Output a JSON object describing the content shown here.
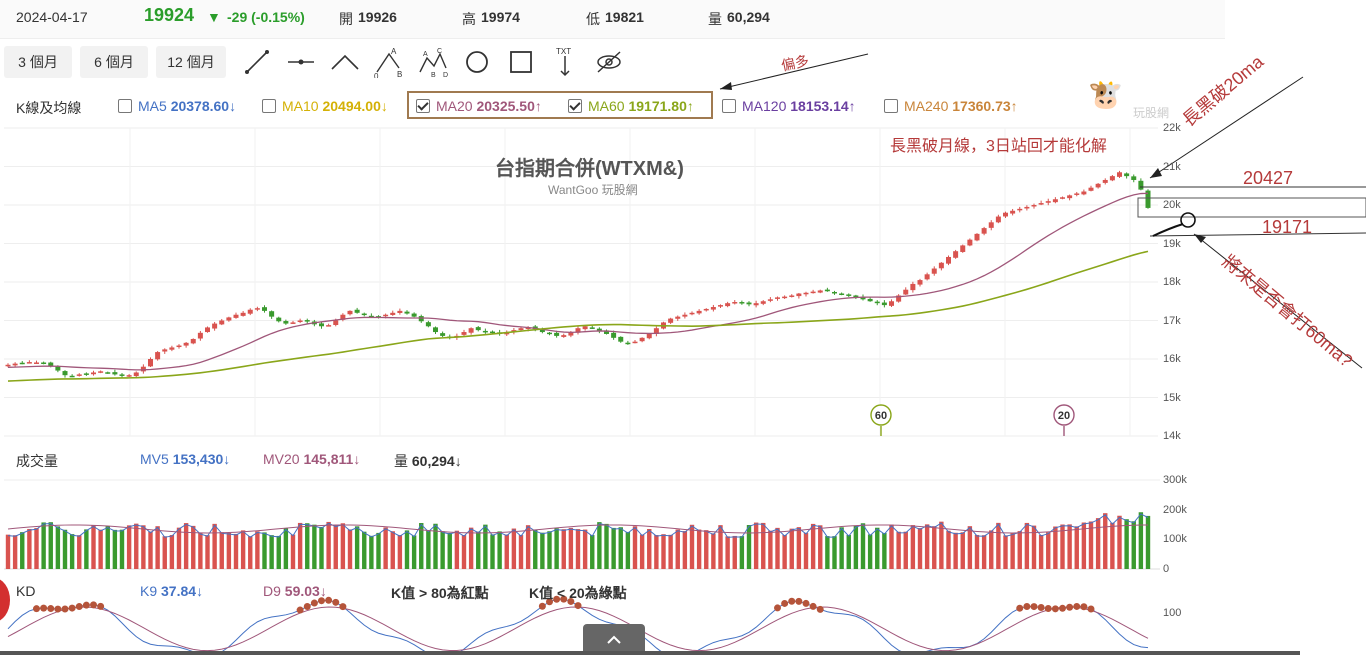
{
  "header": {
    "date": "2024-04-17",
    "price": "19924",
    "change": "-29 (-0.15%)",
    "open_label": "開",
    "open_value": "19926",
    "high_label": "高",
    "high_value": "19974",
    "low_label": "低",
    "low_value": "19821",
    "volume_label": "量",
    "volume_value": "60,294"
  },
  "range_buttons": [
    "3 個月",
    "6 個月",
    "12 個月"
  ],
  "tools": [
    "line-tool-icon",
    "horizontal-line-tool-icon",
    "peak-tool-icon",
    "abc-pattern-icon",
    "abcd-pattern-icon",
    "circle-tool-icon",
    "rectangle-tool-icon",
    "text-arrow-tool-icon",
    "hide-eye-icon"
  ],
  "tool_letters": {
    "a": "A",
    "b": "B",
    "c": "C",
    "d": "D",
    "zero": "0",
    "txt": "TXT"
  },
  "kline": {
    "section_label": "K線及均線",
    "ma": [
      {
        "name": "MA5",
        "value": "20378.60",
        "arrow": "↓",
        "checked": false,
        "color": "#4472c4"
      },
      {
        "name": "MA10",
        "value": "20494.00",
        "arrow": "↓",
        "checked": false,
        "color": "#d4b106"
      },
      {
        "name": "MA20",
        "value": "20325.50",
        "arrow": "↑",
        "checked": true,
        "color": "#a0577a"
      },
      {
        "name": "MA60",
        "value": "19171.80",
        "arrow": "↑",
        "checked": true,
        "color": "#8aa61a"
      },
      {
        "name": "MA120",
        "value": "18153.14",
        "arrow": "↑",
        "checked": false,
        "color": "#6a3fa0"
      },
      {
        "name": "MA240",
        "value": "17360.73",
        "arrow": "↑",
        "checked": false,
        "color": "#c9853a"
      }
    ]
  },
  "watermark": {
    "title": "台指期合併(WTXM&)",
    "subtitle": "WantGoo 玩股網",
    "logo_text": "玩股網"
  },
  "annotations": {
    "bias": "偏多",
    "main_note": "長黑破月線，3日站回才能化解",
    "break_note": "長黑破20ma",
    "level_high": "20427",
    "level_low": "19171",
    "question": "將來是否會打60ma?"
  },
  "price_axis": [
    "22k",
    "21k",
    "20k",
    "19k",
    "18k",
    "17k",
    "16k",
    "15k",
    "14k"
  ],
  "markers": [
    "60",
    "20"
  ],
  "volume": {
    "section_label": "成交量",
    "mv5_label": "MV5",
    "mv5_value": "153,430",
    "mv5_arrow": "↓",
    "mv20_label": "MV20",
    "mv20_value": "145,811",
    "mv20_arrow": "↓",
    "vol_label": "量",
    "vol_value": "60,294",
    "vol_arrow": "↓",
    "axis": [
      "300k",
      "200k",
      "100k",
      "0"
    ]
  },
  "kd": {
    "section_label": "KD",
    "k_label": "K9",
    "k_value": "37.84",
    "k_arrow": "↓",
    "d_label": "D9",
    "d_value": "59.03",
    "d_arrow": "↓",
    "note1": "K值 > 80為紅點",
    "note2": "K值 < 20為綠點",
    "axis": [
      "100"
    ]
  },
  "colors": {
    "up": "#d9534f",
    "down": "#3a9a2e",
    "ma20": "#a0577a",
    "ma60": "#8aa61a",
    "accent_green": "#2a9d2a"
  },
  "chart_data": {
    "type": "candlestick",
    "title": "台指期合併(WTXM&)",
    "ylim": [
      14000,
      22000
    ],
    "yticks": [
      22000,
      21000,
      20000,
      19000,
      18000,
      17000,
      16000,
      15000,
      14000
    ],
    "closes": [
      15850,
      15880,
      15900,
      15920,
      15910,
      15880,
      15820,
      15700,
      15580,
      15560,
      15600,
      15620,
      15650,
      15680,
      15650,
      15600,
      15560,
      15580,
      15650,
      15800,
      16000,
      16180,
      16250,
      16300,
      16350,
      16420,
      16520,
      16680,
      16820,
      16920,
      17000,
      17080,
      17150,
      17200,
      17280,
      17320,
      17250,
      17100,
      16980,
      16920,
      16950,
      17000,
      16980,
      16900,
      16850,
      16880,
      17000,
      17150,
      17250,
      17200,
      17150,
      17120,
      17100,
      17150,
      17200,
      17250,
      17180,
      17100,
      16980,
      16850,
      16700,
      16600,
      16550,
      16600,
      16700,
      16800,
      16750,
      16700,
      16680,
      16650,
      16700,
      16750,
      16800,
      16820,
      16780,
      16700,
      16650,
      16600,
      16620,
      16700,
      16800,
      16850,
      16800,
      16720,
      16650,
      16550,
      16450,
      16400,
      16450,
      16550,
      16650,
      16800,
      16950,
      17050,
      17100,
      17150,
      17200,
      17250,
      17300,
      17350,
      17400,
      17450,
      17480,
      17450,
      17420,
      17450,
      17500,
      17550,
      17600,
      17620,
      17650,
      17700,
      17720,
      17750,
      17780,
      17760,
      17730,
      17700,
      17650,
      17600,
      17550,
      17500,
      17450,
      17400,
      17500,
      17650,
      17800,
      17950,
      18050,
      18200,
      18350,
      18500,
      18650,
      18800,
      18950,
      19100,
      19250,
      19400,
      19550,
      19700,
      19800,
      19850,
      19900,
      19950,
      20000,
      20050,
      20100,
      20150,
      20200,
      20250,
      20300,
      20350,
      20450,
      20550,
      20650,
      20750,
      20850,
      20750,
      20650,
      20400,
      19924
    ],
    "ma20_start": 15780,
    "ma60_start": 15420,
    "volume_axis": [
      0,
      100000,
      200000,
      300000
    ],
    "kd_axis": [
      100
    ]
  }
}
